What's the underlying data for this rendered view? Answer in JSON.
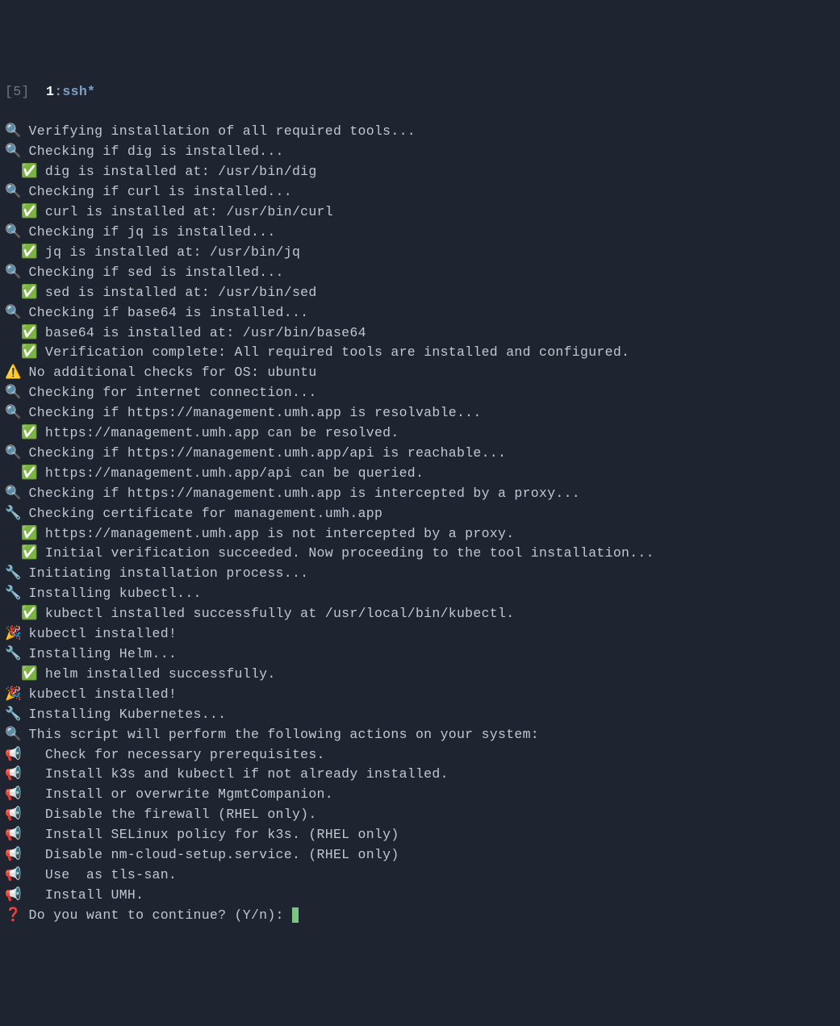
{
  "status": {
    "bracket_open": "[",
    "window_num": "5",
    "bracket_close": "]",
    "tab_num": "1",
    "tab_label": ":ssh*"
  },
  "lines": [
    {
      "icon": "🔍",
      "text": " Verifying installation of all required tools..."
    },
    {
      "icon": "🔍",
      "text": " Checking if dig is installed..."
    },
    {
      "prefix": "  ",
      "icon": "✅",
      "text": " dig is installed at: /usr/bin/dig"
    },
    {
      "icon": "🔍",
      "text": " Checking if curl is installed..."
    },
    {
      "prefix": "  ",
      "icon": "✅",
      "text": " curl is installed at: /usr/bin/curl"
    },
    {
      "icon": "🔍",
      "text": " Checking if jq is installed..."
    },
    {
      "prefix": "  ",
      "icon": "✅",
      "text": " jq is installed at: /usr/bin/jq"
    },
    {
      "icon": "🔍",
      "text": " Checking if sed is installed..."
    },
    {
      "prefix": "  ",
      "icon": "✅",
      "text": " sed is installed at: /usr/bin/sed"
    },
    {
      "icon": "🔍",
      "text": " Checking if base64 is installed..."
    },
    {
      "prefix": "  ",
      "icon": "✅",
      "text": " base64 is installed at: /usr/bin/base64"
    },
    {
      "prefix": "  ",
      "icon": "✅",
      "text": " Verification complete: All required tools are installed and configured."
    },
    {
      "icon": "⚠️",
      "text": " No additional checks for OS: ubuntu"
    },
    {
      "icon": "🔍",
      "text": " Checking for internet connection..."
    },
    {
      "icon": "🔍",
      "text": " Checking if https://management.umh.app is resolvable..."
    },
    {
      "prefix": "  ",
      "icon": "✅",
      "text": " https://management.umh.app can be resolved."
    },
    {
      "icon": "🔍",
      "text": " Checking if https://management.umh.app/api is reachable..."
    },
    {
      "prefix": "  ",
      "icon": "✅",
      "text": " https://management.umh.app/api can be queried."
    },
    {
      "icon": "🔍",
      "text": " Checking if https://management.umh.app is intercepted by a proxy..."
    },
    {
      "icon": "🔧",
      "text": " Checking certificate for management.umh.app"
    },
    {
      "prefix": "  ",
      "icon": "✅",
      "text": " https://management.umh.app is not intercepted by a proxy."
    },
    {
      "prefix": "  ",
      "icon": "✅",
      "text": " Initial verification succeeded. Now proceeding to the tool installation..."
    },
    {
      "icon": "🔧",
      "text": " Initiating installation process..."
    },
    {
      "icon": "🔧",
      "text": " Installing kubectl..."
    },
    {
      "prefix": "  ",
      "icon": "✅",
      "text": " kubectl installed successfully at /usr/local/bin/kubectl."
    },
    {
      "icon": "🎉",
      "text": " kubectl installed!"
    },
    {
      "icon": "🔧",
      "text": " Installing Helm..."
    },
    {
      "prefix": "  ",
      "icon": "✅",
      "text": " helm installed successfully."
    },
    {
      "icon": "🎉",
      "text": " kubectl installed!"
    },
    {
      "icon": "🔧",
      "text": " Installing Kubernetes..."
    },
    {
      "icon": "🔍",
      "text": " This script will perform the following actions on your system:"
    },
    {
      "icon": "📢",
      "text": "   Check for necessary prerequisites."
    },
    {
      "icon": "📢",
      "text": "   Install k3s and kubectl if not already installed."
    },
    {
      "icon": "📢",
      "text": "   Install or overwrite MgmtCompanion."
    },
    {
      "icon": "📢",
      "text": "   Disable the firewall (RHEL only)."
    },
    {
      "icon": "📢",
      "text": "   Install SELinux policy for k3s. (RHEL only)"
    },
    {
      "icon": "📢",
      "text": "   Disable nm-cloud-setup.service. (RHEL only)"
    },
    {
      "icon": "📢",
      "text": "   Use  as tls-san."
    },
    {
      "icon": "📢",
      "text": "   Install UMH."
    },
    {
      "icon": "❓",
      "iconClass": "red",
      "text": " Do you want to continue? (Y/n): ",
      "cursor": true
    }
  ]
}
